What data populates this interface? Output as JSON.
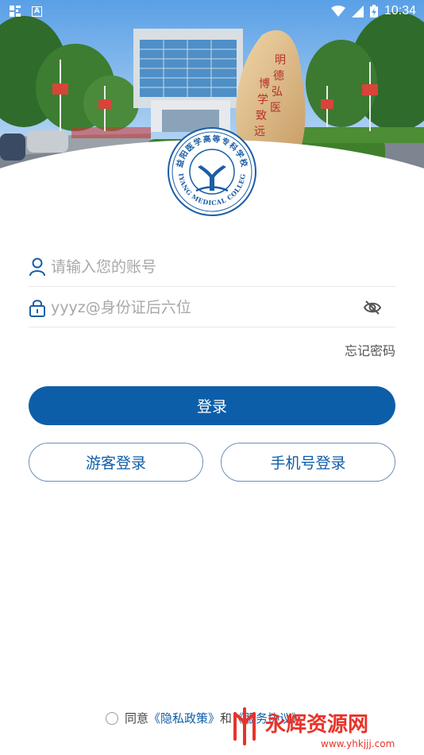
{
  "status": {
    "time": "10:34",
    "left_icons": [
      "qr-scan-icon",
      "app-a-icon"
    ],
    "right_icons": [
      "wifi-icon",
      "signal-icon",
      "battery-icon"
    ]
  },
  "hero": {
    "stone_text": "明德弘医 博学致远"
  },
  "logo": {
    "top_text": "益阳医学高等专科学校",
    "bottom_text": "YIYANG MEDICAL COLLEGE",
    "center_glyph": "Y"
  },
  "form": {
    "account_placeholder": "请输入您的账号",
    "account_icon": "user-icon",
    "password_placeholder": "yyyz@身份证后六位",
    "password_icon": "lock-icon",
    "visibility_icon": "eye-off-icon",
    "forgot_label": "忘记密码"
  },
  "buttons": {
    "login": "登录",
    "guest": "游客登录",
    "phone": "手机号登录"
  },
  "agreement": {
    "prefix": "同意",
    "privacy": "《隐私政策》",
    "connector": "和",
    "service": "《服务协议》"
  },
  "watermark": {
    "name": "永辉资源网",
    "url": "www.yhkjjj.com"
  },
  "colors": {
    "primary": "#0d5ea9",
    "outline": "#6f8fb6",
    "watermark": "#e8332a"
  }
}
